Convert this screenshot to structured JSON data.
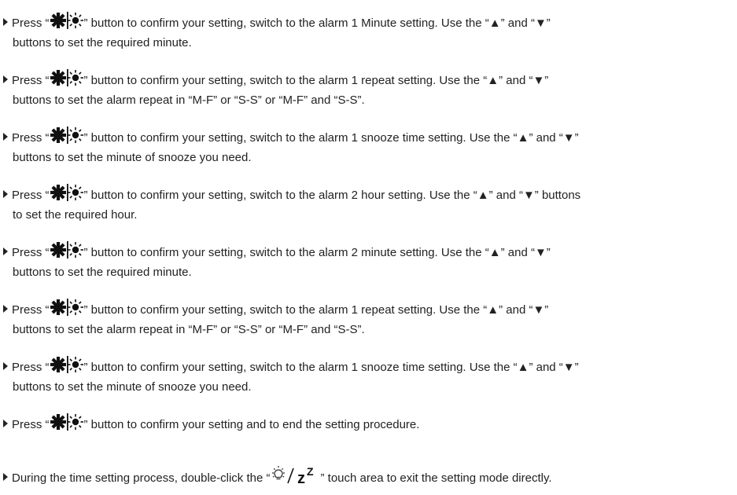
{
  "manual": {
    "steps": [
      {
        "prefix": "Press “",
        "icon": "settings-light-icon",
        "line1_rest": "” button to confirm your setting, switch to the alarm 1 Minute setting. Use the “▲” and “▼”",
        "line2": "buttons to set the required minute."
      },
      {
        "prefix": "Press “",
        "icon": "settings-light-icon",
        "line1_rest": "” button to confirm your setting, switch to the alarm 1 repeat setting. Use the “▲” and “▼”",
        "line2": "buttons to set the alarm repeat in “M-F” or “S-S” or “M-F” and “S-S”."
      },
      {
        "prefix": "Press “",
        "icon": "settings-light-icon",
        "line1_rest": "” button to confirm your setting, switch to the alarm 1 snooze time setting. Use the “▲” and “▼”",
        "line2": "buttons to set the minute of snooze you need."
      },
      {
        "prefix": "Press “",
        "icon": "settings-light-icon",
        "line1_rest": "” button to confirm your setting, switch to the alarm 2 hour setting. Use the “▲” and “▼” buttons",
        "line2": "to set the required hour."
      },
      {
        "prefix": "Press “",
        "icon": "settings-light-icon",
        "line1_rest": "” button to confirm your setting, switch to the alarm 2 minute setting. Use the “▲” and “▼”",
        "line2": "buttons to set the required minute."
      },
      {
        "prefix": "Press “",
        "icon": "settings-light-icon",
        "line1_rest": "” button to confirm your setting, switch to the alarm 1 repeat setting. Use the “▲” and “▼”",
        "line2": "buttons to set the alarm repeat in “M-F” or “S-S” or “M-F” and “S-S”."
      },
      {
        "prefix": "Press “",
        "icon": "settings-light-icon",
        "line1_rest": "” button to confirm your setting, switch to the alarm 1 snooze time setting. Use the “▲” and “▼”",
        "line2": "buttons to set the minute of snooze you need."
      },
      {
        "prefix": "Press “",
        "icon": "settings-light-icon",
        "line1_rest": "” button to confirm your setting and to end the setting procedure."
      },
      {
        "prefix": "During the time setting process, double-click the “",
        "icon": "light-snooze-icon",
        "line1_rest": "” touch area to exit the setting mode directly."
      }
    ]
  },
  "colors": {
    "text": "#222222",
    "background": "#ffffff"
  }
}
